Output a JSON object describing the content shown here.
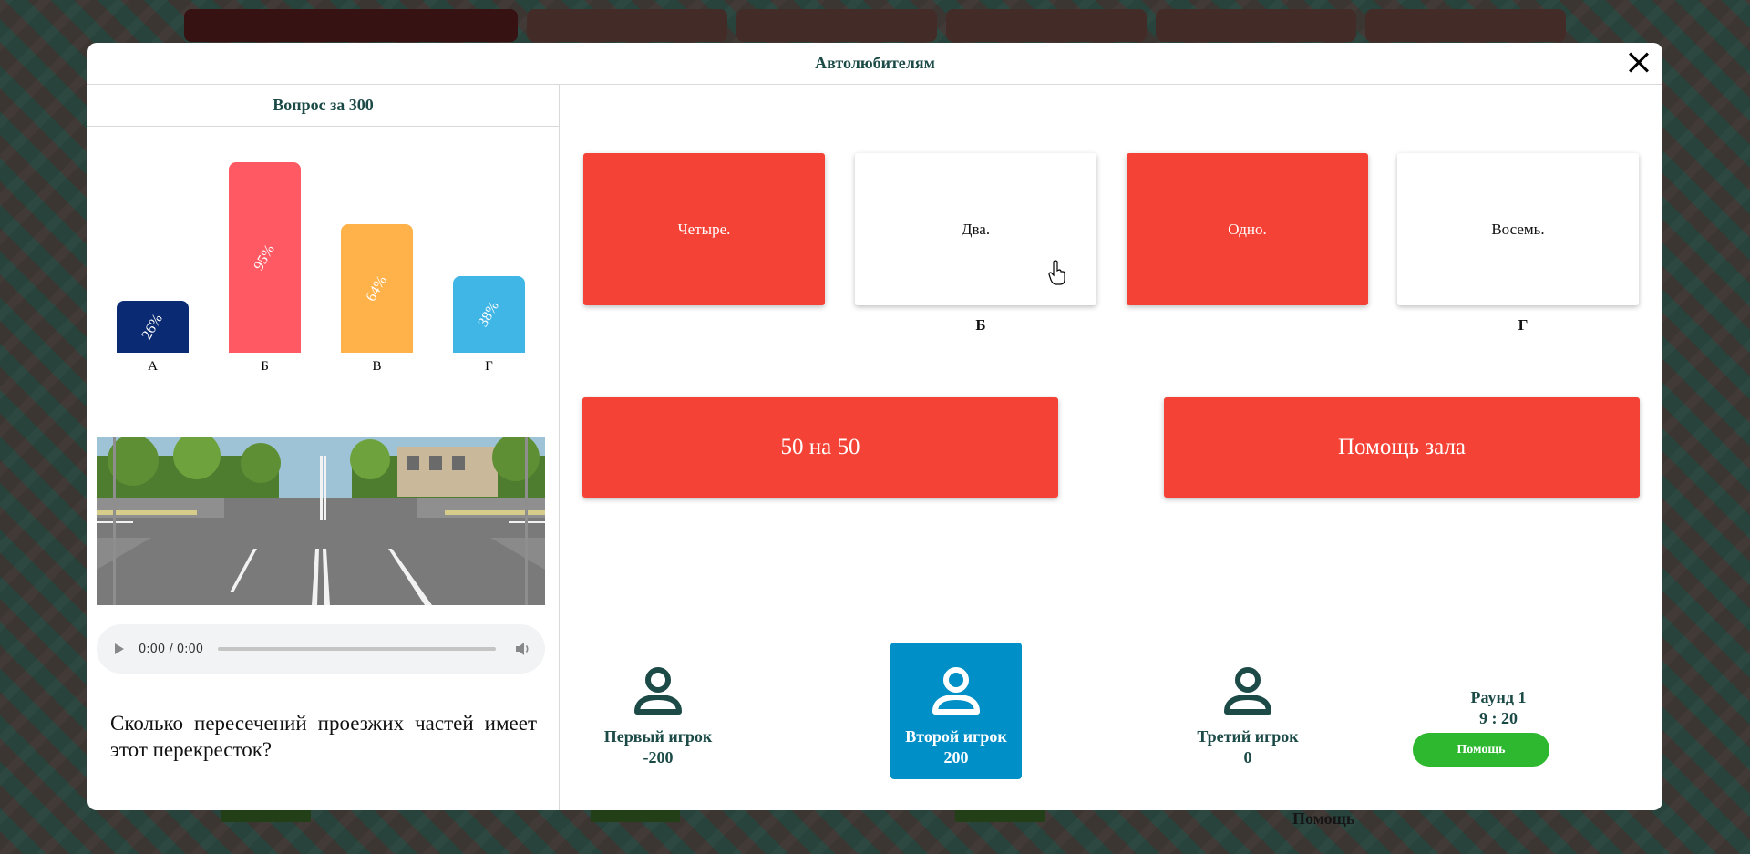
{
  "modal": {
    "title": "Автолюбителям",
    "question_header": "Вопрос за 300"
  },
  "chart_data": {
    "type": "bar",
    "categories": [
      "А",
      "Б",
      "В",
      "Г"
    ],
    "values": [
      26,
      95,
      64,
      38
    ],
    "value_labels": [
      "26%",
      "95%",
      "64%",
      "38%"
    ],
    "colors": [
      "#0a2a73",
      "#ff5a64",
      "#ffb24a",
      "#40b6e6"
    ],
    "ylim": [
      0,
      100
    ]
  },
  "audio": {
    "time": "0:00 / 0:00"
  },
  "question": {
    "text": "Сколько пересечений проезжих частей имеет этот перекресток?"
  },
  "answers": [
    {
      "text": "Четыре.",
      "style": "red",
      "letter": ""
    },
    {
      "text": "Два.",
      "style": "white",
      "letter": "Б"
    },
    {
      "text": "Одно.",
      "style": "red",
      "letter": ""
    },
    {
      "text": "Восемь.",
      "style": "white",
      "letter": "Г"
    }
  ],
  "lifelines": {
    "fifty_fifty": "50 на 50",
    "audience": "Помощь зала"
  },
  "players": [
    {
      "name": "Первый игрок",
      "score": "-200",
      "active": false
    },
    {
      "name": "Второй игрок",
      "score": "200",
      "active": true
    },
    {
      "name": "Третий игрок",
      "score": "0",
      "active": false
    }
  ],
  "round": {
    "label": "Раунд 1",
    "timer": "9 : 20",
    "help_label": "Помощь"
  },
  "background": {
    "help_label": "Помощь"
  },
  "icons": {
    "close": "close-icon",
    "player": "user-icon",
    "play": "play-icon",
    "volume": "volume-icon",
    "cursor": "hand-cursor-icon"
  }
}
